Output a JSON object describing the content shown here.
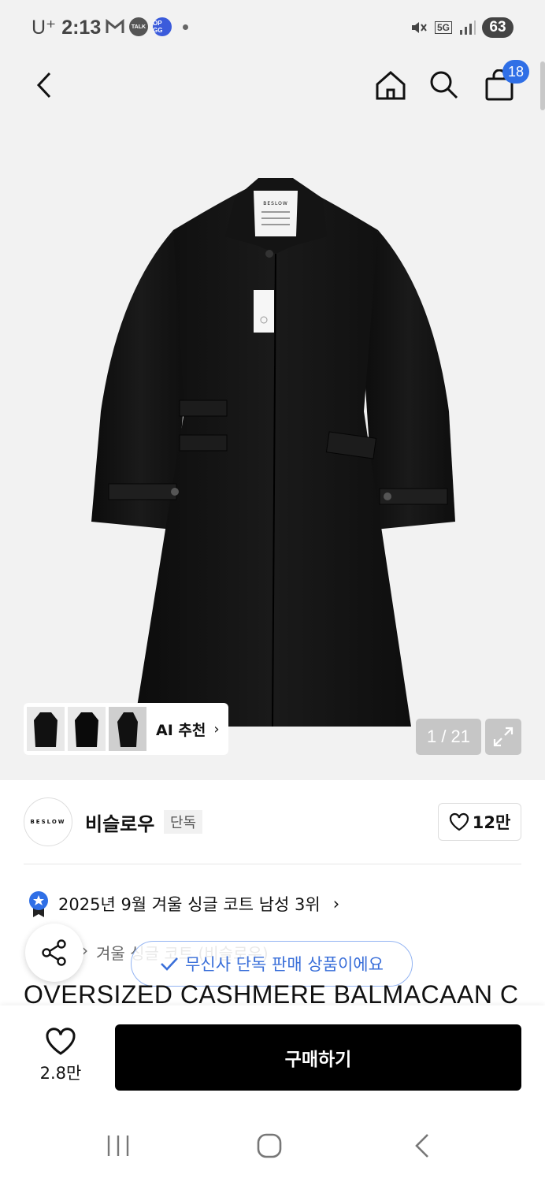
{
  "status_bar": {
    "carrier": "U⁺",
    "time": "2:13",
    "talk_badge": "TALK",
    "opgg_badge": "OP GG",
    "network": "5G",
    "battery": "63"
  },
  "nav": {
    "cart_count": "18"
  },
  "gallery": {
    "ai_recommend_label": "AI 추천",
    "image_counter": "1 / 21",
    "garment_tag_text": "BESLOW"
  },
  "brand": {
    "logo_text": "BESLOW",
    "name": "비슬로우",
    "exclusive_tag": "단독",
    "like_count": "12만"
  },
  "ranking": {
    "text": "2025년 9월 겨울 싱글 코트 남성 3위"
  },
  "breadcrumb": {
    "items": [
      "겨울 싱글 코트 (비슬로우)"
    ]
  },
  "toast": {
    "message": "무신사 단독 판매 상품이에요"
  },
  "product": {
    "title": "OVERSIZED CASHMERE BALMACAAN C"
  },
  "actions": {
    "favorite_count": "2.8만",
    "buy_label": "구매하기"
  },
  "colors": {
    "accent_blue": "#2f6fe6",
    "toast_blue": "#3a6fd9",
    "buy_button": "#000000"
  }
}
